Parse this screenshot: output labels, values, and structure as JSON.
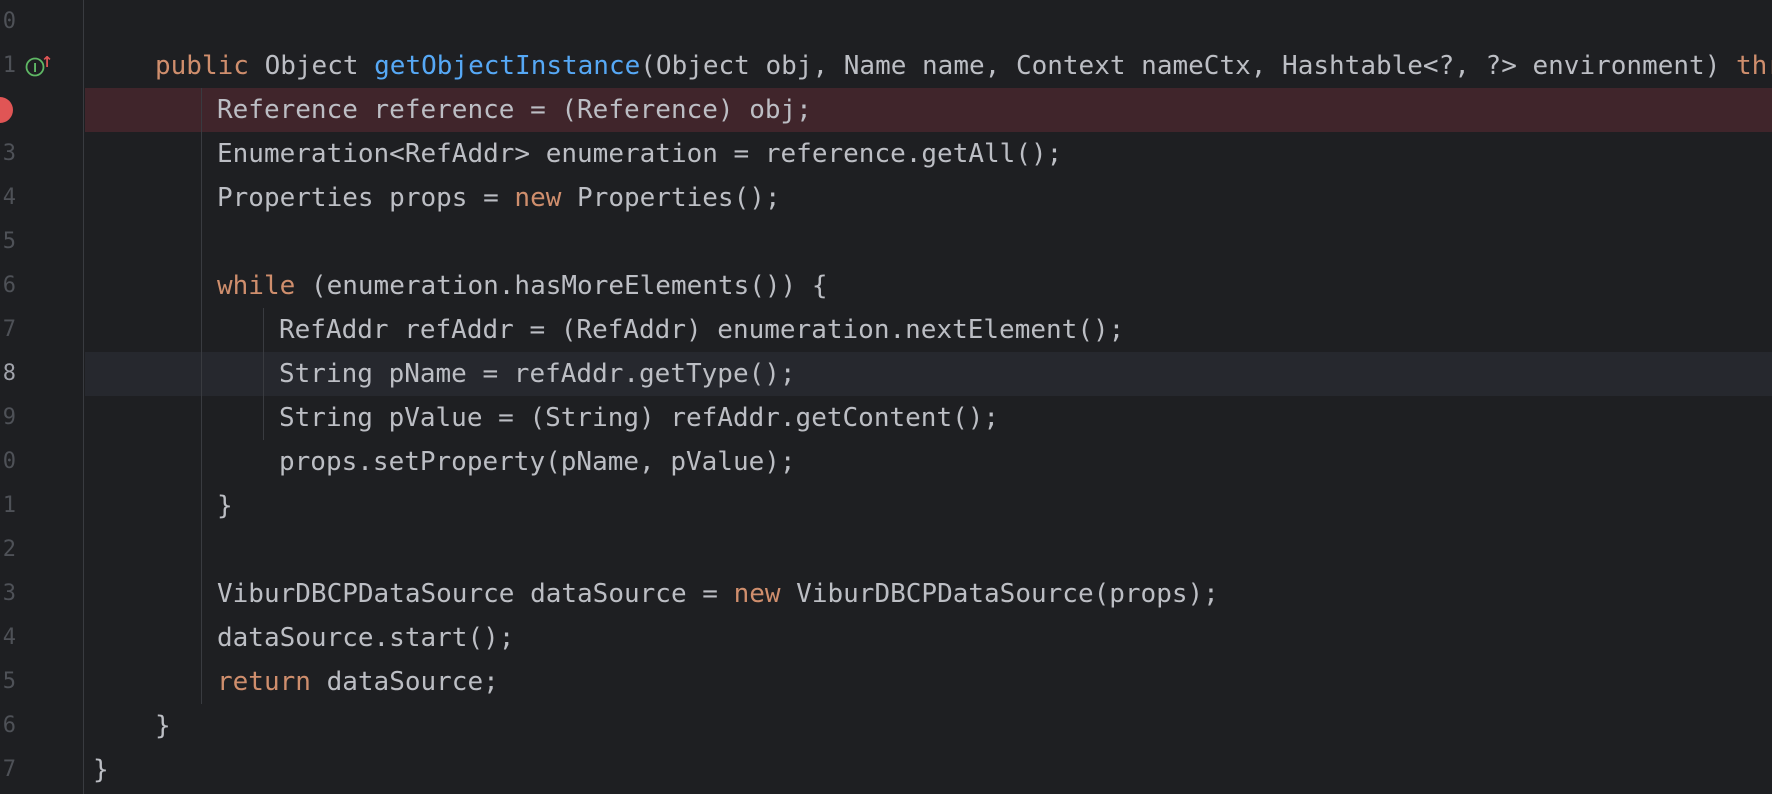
{
  "editor": {
    "colors": {
      "background": "#1e1f22",
      "plain": "#bcbec4",
      "keyword": "#cf8e6d",
      "method": "#56a8f5",
      "line_number": "#4e5157",
      "current_line_number": "#a1a3ab",
      "breakpoint_line": "#40252b",
      "current_line": "#26282e",
      "breakpoint": "#e05555",
      "implements_icon": "#5fb865"
    },
    "gutter": {
      "line_numbers": [
        "0",
        "1",
        "",
        "3",
        "4",
        "5",
        "6",
        "7",
        "8",
        "9",
        "0",
        "1",
        "2",
        "3",
        "4",
        "5",
        "6",
        "7"
      ],
      "current_line_index": 8,
      "breakpoint_line_index": 2,
      "implements_line_index": 1,
      "implements_icon_glyph": "I",
      "implements_arrow_glyph": "↑"
    },
    "lines": [
      [],
      [
        {
          "t": "public",
          "k": "keyword"
        },
        {
          "t": " Object ",
          "k": "plain"
        },
        {
          "t": "getObjectInstance",
          "k": "method"
        },
        {
          "t": "(Object obj, Name name, Context nameCtx, Hashtable<?, ?> environment) ",
          "k": "plain"
        },
        {
          "t": "thr",
          "k": "keyword"
        }
      ],
      [
        {
          "t": "Reference reference = (Reference) obj;",
          "k": "plain"
        }
      ],
      [
        {
          "t": "Enumeration<RefAddr> enumeration = reference.getAll();",
          "k": "plain"
        }
      ],
      [
        {
          "t": "Properties props = ",
          "k": "plain"
        },
        {
          "t": "new",
          "k": "keyword"
        },
        {
          "t": " Properties();",
          "k": "plain"
        }
      ],
      [],
      [
        {
          "t": "while",
          "k": "keyword"
        },
        {
          "t": " (enumeration.hasMoreElements()) {",
          "k": "plain"
        }
      ],
      [
        {
          "t": "RefAddr refAddr = (RefAddr) enumeration.nextElement();",
          "k": "plain"
        }
      ],
      [
        {
          "t": "String pName = refAddr.getType();",
          "k": "plain"
        }
      ],
      [
        {
          "t": "String pValue = (String) refAddr.getContent();",
          "k": "plain"
        }
      ],
      [
        {
          "t": "props.setProperty(pName, pValue);",
          "k": "plain"
        }
      ],
      [
        {
          "t": "}",
          "k": "plain"
        }
      ],
      [],
      [
        {
          "t": "ViburDBCPDataSource dataSource = ",
          "k": "plain"
        },
        {
          "t": "new",
          "k": "keyword"
        },
        {
          "t": " ViburDBCPDataSource(props);",
          "k": "plain"
        }
      ],
      [
        {
          "t": "dataSource.start();",
          "k": "plain"
        }
      ],
      [
        {
          "t": "return",
          "k": "keyword"
        },
        {
          "t": " dataSource;",
          "k": "plain"
        }
      ],
      [
        {
          "t": "}",
          "k": "plain"
        }
      ],
      [
        {
          "t": "}",
          "k": "plain"
        }
      ]
    ]
  }
}
